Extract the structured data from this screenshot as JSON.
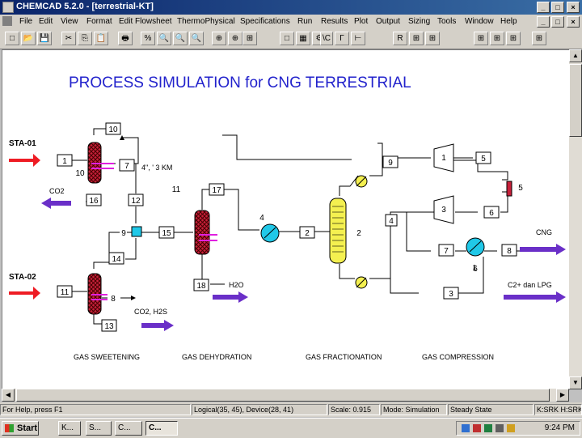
{
  "window": {
    "title": "CHEMCAD 5.2.0 - [terrestrial-KT]",
    "min": "_",
    "max": "□",
    "close": "×"
  },
  "menu": [
    "File",
    "Edit",
    "View",
    "Format",
    "Edit Flowsheet",
    "ThermoPhysical",
    "Specifications",
    "Run",
    "Results",
    "Plot",
    "Output",
    "Sizing",
    "Tools",
    "Window",
    "Help"
  ],
  "toolbar": [
    "□",
    "📂",
    "💾",
    "✂",
    "⎘",
    "📋",
    "🖶",
    "%",
    "🔍",
    "🔍",
    "🔍",
    "⊕",
    "⊕",
    "⊞",
    "□",
    "▦",
    "⚙",
    "\\C",
    "Γ",
    "⊢",
    "R",
    "⊞",
    "⊞",
    "⊞",
    "⊞",
    "⊞",
    "⊞"
  ],
  "flowsheet": {
    "title": "PROCESS SIMULATION for CNG TERRESTRIAL",
    "labels": {
      "sta01": "STA-01",
      "sta02": "STA-02",
      "co2": "CO2",
      "h2o": "H2O",
      "co2h2s": "CO2, H2S",
      "cng": "CNG",
      "c2lpg": "C2+ dan LPG",
      "distance": "4\", ' 3 KM"
    },
    "sections": [
      "GAS SWEETENING",
      "GAS DEHYDRATION",
      "GAS FRACTIONATION",
      "GAS COMPRESSION"
    ],
    "streams": [
      "10",
      "1",
      "10",
      "7",
      "16",
      "12",
      "11",
      "17",
      "9",
      "15",
      "14",
      "18",
      "11",
      "8",
      "13",
      "4",
      "2",
      "9",
      "1",
      "5",
      "6",
      "7",
      "8",
      "3",
      "4"
    ],
    "units": [
      "2",
      "1",
      "3",
      "5",
      "6"
    ],
    "colors": {
      "feed": "#ee1c24",
      "product": "#6a2fc8",
      "vessel": "#c8203a",
      "column": "#f4f050",
      "exchanger": "#20c8e8"
    }
  },
  "status": {
    "help": "For Help, press F1",
    "logical": "Logical(35, 45), Device(28, 41)",
    "scale": "Scale: 0.915",
    "mode": "Mode: Simulation",
    "state": "Steady State",
    "thermo": "K:SRK  H:SRK"
  },
  "taskbar": {
    "start": "Start",
    "buttons": [
      "K...",
      "S...",
      "C...",
      "C..."
    ],
    "clock": "9:24 PM"
  }
}
